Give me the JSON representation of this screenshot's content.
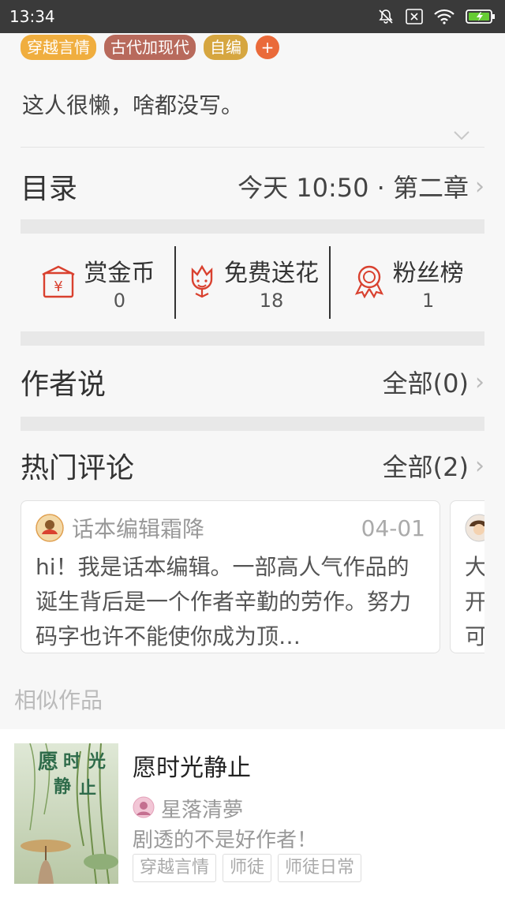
{
  "status_bar": {
    "time": "13:34"
  },
  "tags": [
    {
      "label": "穿越言情",
      "color": "#f0ae3f"
    },
    {
      "label": "古代加现代",
      "color": "#b86a5c"
    },
    {
      "label": "自编",
      "color": "#d6a640"
    }
  ],
  "tag_add_label": "+",
  "intro": "这人很懒，啥都没写。",
  "catalog": {
    "title": "目录",
    "latest": "今天 10:50 · 第二章"
  },
  "stats": [
    {
      "label": "赏金币",
      "value": "0",
      "icon": "red-envelope-icon"
    },
    {
      "label": "免费送花",
      "value": "18",
      "icon": "flower-icon"
    },
    {
      "label": "粉丝榜",
      "value": "1",
      "icon": "medal-icon"
    }
  ],
  "author_says": {
    "title": "作者说",
    "all_label": "全部(0)"
  },
  "hot_comments": {
    "title": "热门评论",
    "all_label": "全部(2)",
    "items": [
      {
        "author": "话本编辑霜降",
        "date": "04-01",
        "text": "hi！我是话本编辑。一部高人气作品的诞生背后是一个作者辛勤的劳作。努力码字也许不能使你成为顶…"
      },
      {
        "author": "",
        "date": "",
        "text": "大开可"
      }
    ]
  },
  "similar": {
    "label": "相似作品",
    "books": [
      {
        "title": "愿时光静止",
        "cover_text": "愿时光静止",
        "author": "星落清夢",
        "desc": "剧透的不是好作者！",
        "tags": [
          "穿越言情",
          "师徒",
          "师徒日常"
        ]
      }
    ]
  },
  "colors": {
    "accent_red": "#d9412f",
    "tag_add": "#ea6a3a"
  }
}
